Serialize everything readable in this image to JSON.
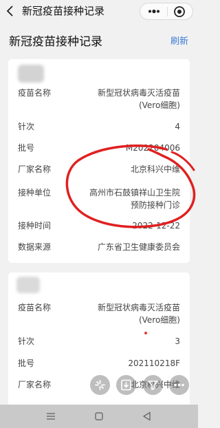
{
  "nav": {
    "back_icon": "chevron-left-icon",
    "title": "新冠疫苗接种记录",
    "capsule_icons": [
      "more-dots-icon",
      "close-circle-icon"
    ]
  },
  "page": {
    "title": "新冠疫苗接种记录",
    "refresh_label": "刷新",
    "refresh_color": "#3b7bd4"
  },
  "records": [
    {
      "rows": [
        {
          "label": "疫苗名称",
          "value_line1": "新型冠状病毒灭活疫苗",
          "value_line2": "(Vero细胞)"
        },
        {
          "label": "针次",
          "value": "4"
        },
        {
          "label": "批号",
          "value": "M202204006"
        },
        {
          "label": "厂家名称",
          "value": "北京科兴中维"
        },
        {
          "label": "接种单位",
          "value_line1": "高州市石鼓镇祥山卫生院",
          "value_line2": "预防接种门诊"
        },
        {
          "label": "接种时间",
          "value": "2022-12-22"
        },
        {
          "label": "数据来源",
          "value": "广东省卫生健康委员会"
        }
      ]
    },
    {
      "rows": [
        {
          "label": "疫苗名称",
          "value_line1": "新型冠状病毒灭活疫苗",
          "value_line2": "(Vero细胞)"
        },
        {
          "label": "针次",
          "value": "3"
        },
        {
          "label": "批号",
          "value": "202110218F"
        },
        {
          "label": "厂家名称",
          "value": "北京科兴中维"
        }
      ]
    }
  ],
  "annotation_color": "#e02020",
  "float_icons": [
    "spark-icon",
    "download-icon",
    "filter-icon",
    "more-icon"
  ],
  "system_nav_icons": [
    "menu-icon",
    "home-square-icon",
    "back-triangle-icon"
  ]
}
